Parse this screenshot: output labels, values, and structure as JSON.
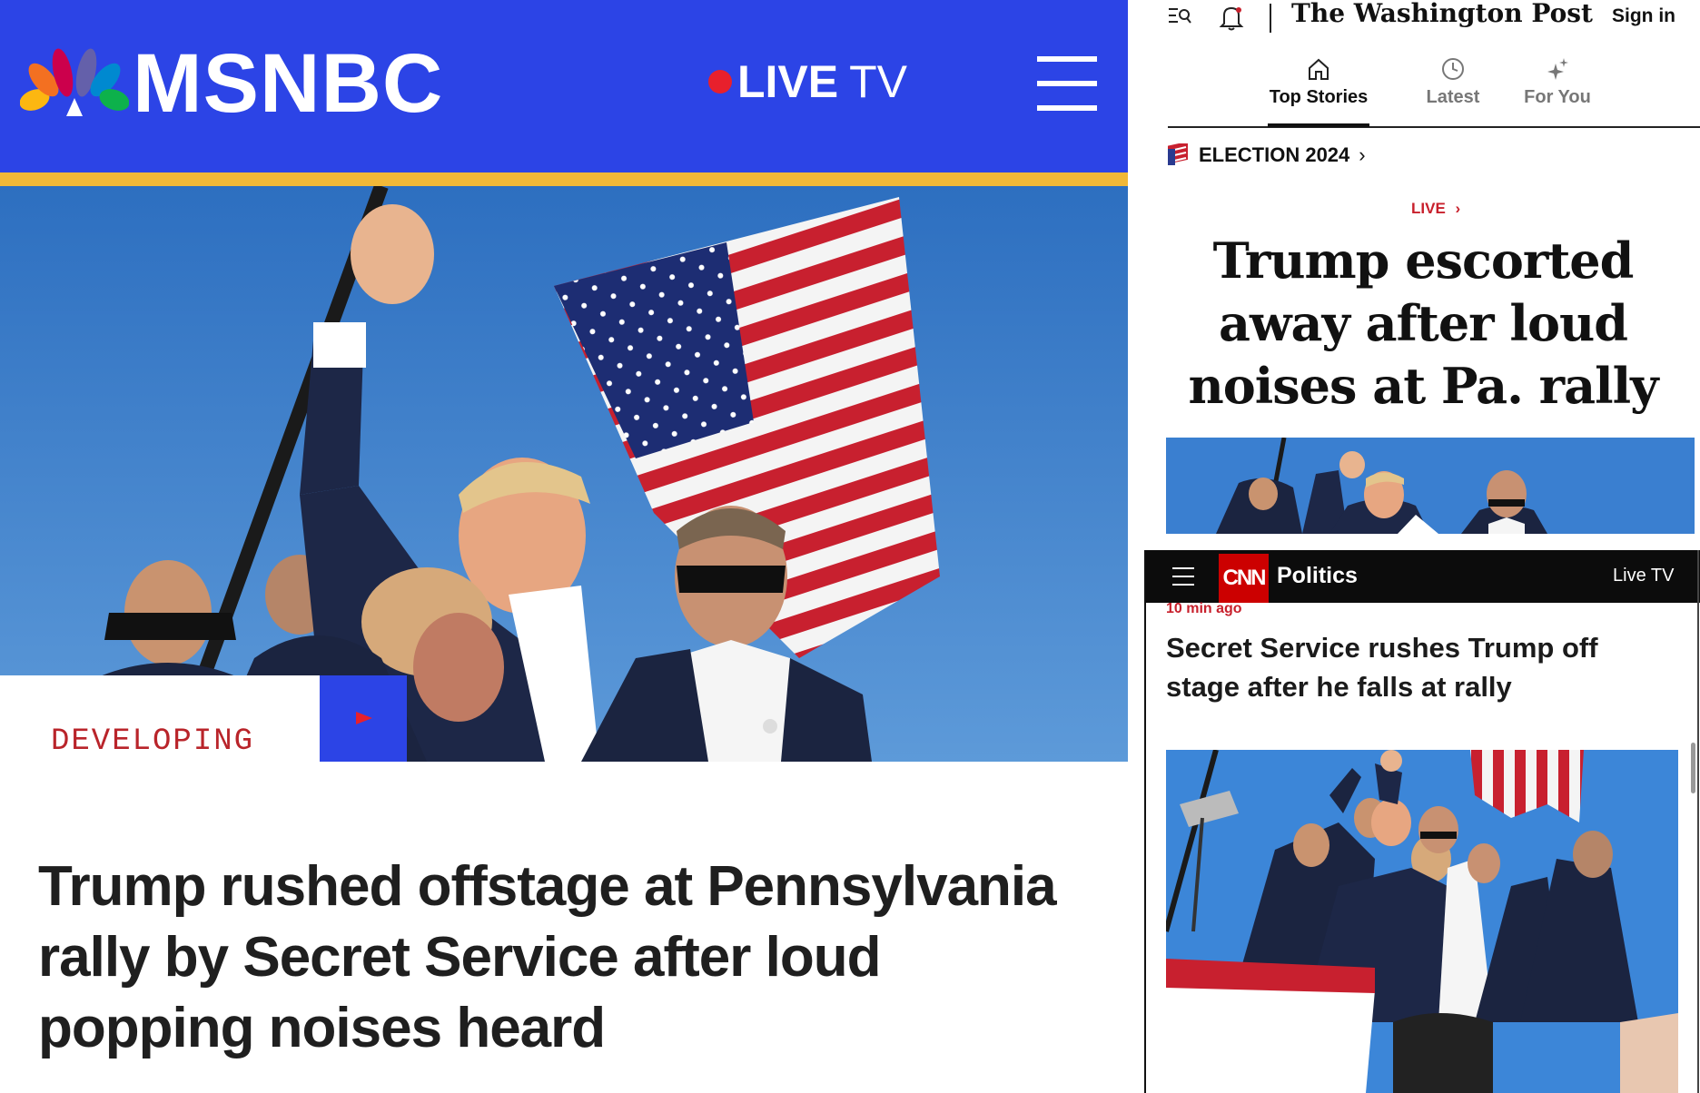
{
  "msnbc": {
    "brand": "MSNBC",
    "live_label": "LIVE",
    "tv_label": "TV",
    "tag": "DEVELOPING",
    "headline": "Trump rushed offstage at Pennsylvania rally by Secret Service after loud popping noises heard",
    "colors": {
      "header": "#2c44e6",
      "gold_bar": "#f1b838",
      "tag_text": "#b9242a",
      "live_dot": "#e8202c"
    }
  },
  "wapo": {
    "brand": "The Washington Post",
    "sign_in": "Sign in",
    "tabs": [
      {
        "label": "Top Stories",
        "icon": "home-icon",
        "active": true
      },
      {
        "label": "Latest",
        "icon": "clock-icon",
        "active": false
      },
      {
        "label": "For You",
        "icon": "sparkle-icon",
        "active": false
      }
    ],
    "section": "ELECTION 2024",
    "live_label": "LIVE",
    "headline": "Trump escorted away after loud noises at Pa. rally",
    "colors": {
      "live": "#c8202c"
    }
  },
  "cnn": {
    "logo": "CNN",
    "section": "Politics",
    "live_tv": "Live TV",
    "time": "10 min ago",
    "headline": "Secret Service rushes Trump off stage after he falls at rally",
    "colors": {
      "bar": "#0c0c0c",
      "logo": "#cc0000",
      "time": "#c8202c"
    }
  }
}
